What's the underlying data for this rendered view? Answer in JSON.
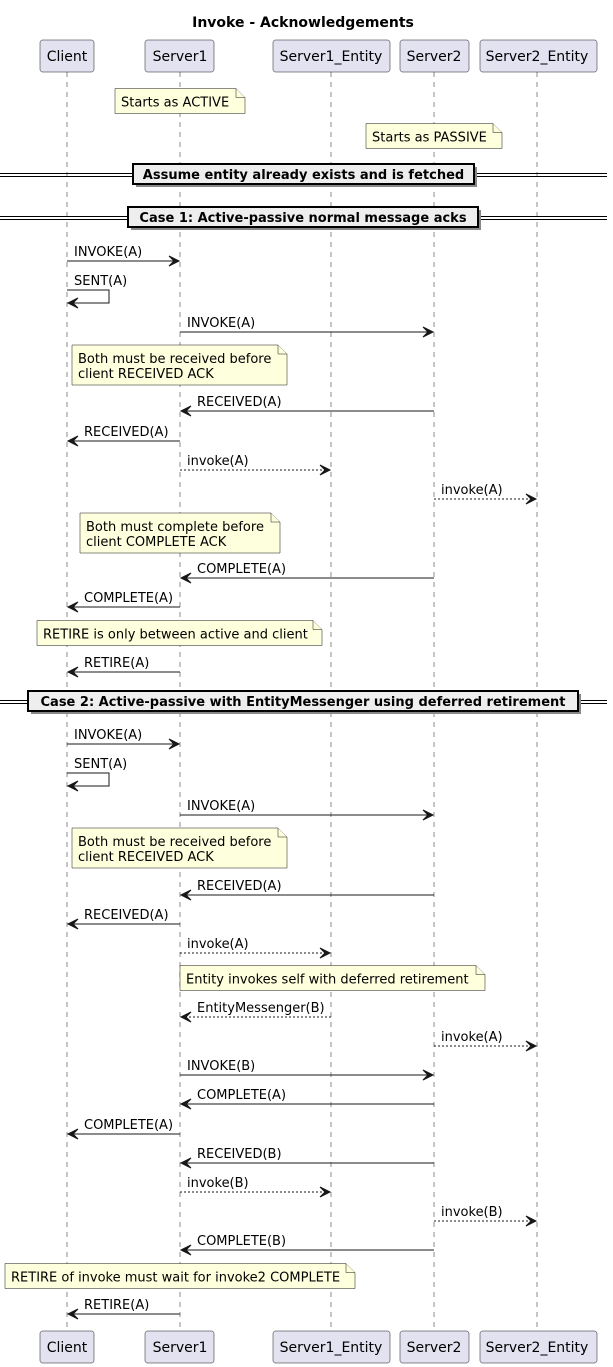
{
  "title": "Invoke - Acknowledgements",
  "participants": [
    {
      "id": "client",
      "label": "Client"
    },
    {
      "id": "server1",
      "label": "Server1"
    },
    {
      "id": "server1_entity",
      "label": "Server1_Entity"
    },
    {
      "id": "server2",
      "label": "Server2"
    },
    {
      "id": "server2_entity",
      "label": "Server2_Entity"
    }
  ],
  "colors": {
    "participant_fill": "#E2E2F0",
    "note_fill": "#FEFFDD",
    "divider_fill": "#EEEEEE",
    "line": "#181818"
  },
  "steps": [
    {
      "kind": "note",
      "over": "server1",
      "lines": [
        "Starts as ACTIVE"
      ]
    },
    {
      "kind": "note",
      "over": "server2",
      "lines": [
        "Starts as PASSIVE"
      ]
    },
    {
      "kind": "divider",
      "text": "Assume entity already exists and is fetched"
    },
    {
      "kind": "divider",
      "text": "Case 1:  Active-passive normal message acks"
    },
    {
      "kind": "message",
      "from": "client",
      "to": "server1",
      "label": "INVOKE(A)",
      "style": "solid"
    },
    {
      "kind": "message",
      "from": "client",
      "to": "client",
      "label": "SENT(A)",
      "style": "solid"
    },
    {
      "kind": "message",
      "from": "server1",
      "to": "server2",
      "label": "INVOKE(A)",
      "style": "solid"
    },
    {
      "kind": "note",
      "over": "client-server1",
      "lines": [
        "Both must be received before",
        "client RECEIVED ACK"
      ]
    },
    {
      "kind": "message",
      "from": "server2",
      "to": "server1",
      "label": "RECEIVED(A)",
      "style": "solid"
    },
    {
      "kind": "message",
      "from": "server1",
      "to": "client",
      "label": "RECEIVED(A)",
      "style": "solid"
    },
    {
      "kind": "message",
      "from": "server1",
      "to": "server1_entity",
      "label": "invoke(A)",
      "style": "dashed"
    },
    {
      "kind": "message",
      "from": "server2",
      "to": "server2_entity",
      "label": "invoke(A)",
      "style": "dashed"
    },
    {
      "kind": "note",
      "over": "client-server1",
      "lines": [
        "Both must complete before",
        "client COMPLETE ACK"
      ]
    },
    {
      "kind": "message",
      "from": "server2",
      "to": "server1",
      "label": "COMPLETE(A)",
      "style": "solid"
    },
    {
      "kind": "message",
      "from": "server1",
      "to": "client",
      "label": "COMPLETE(A)",
      "style": "solid"
    },
    {
      "kind": "note",
      "over": "client-server1_entity",
      "lines": [
        "RETIRE is only between active and client"
      ]
    },
    {
      "kind": "message",
      "from": "server1",
      "to": "client",
      "label": "RETIRE(A)",
      "style": "solid"
    },
    {
      "kind": "divider",
      "text": "Case 2:  Active-passive with EntityMessenger using deferred retirement"
    },
    {
      "kind": "message",
      "from": "client",
      "to": "server1",
      "label": "INVOKE(A)",
      "style": "solid"
    },
    {
      "kind": "message",
      "from": "client",
      "to": "client",
      "label": "SENT(A)",
      "style": "solid"
    },
    {
      "kind": "message",
      "from": "server1",
      "to": "server2",
      "label": "INVOKE(A)",
      "style": "solid"
    },
    {
      "kind": "note",
      "over": "client-server1",
      "lines": [
        "Both must be received before",
        "client RECEIVED ACK"
      ]
    },
    {
      "kind": "message",
      "from": "server2",
      "to": "server1",
      "label": "RECEIVED(A)",
      "style": "solid"
    },
    {
      "kind": "message",
      "from": "server1",
      "to": "client",
      "label": "RECEIVED(A)",
      "style": "solid"
    },
    {
      "kind": "message",
      "from": "server1",
      "to": "server1_entity",
      "label": "invoke(A)",
      "style": "dashed"
    },
    {
      "kind": "note",
      "over": "server1-server2",
      "lines": [
        "Entity invokes self with deferred retirement"
      ]
    },
    {
      "kind": "message",
      "from": "server1_entity",
      "to": "server1",
      "label": "EntityMessenger(B)",
      "style": "dashed"
    },
    {
      "kind": "message",
      "from": "server2",
      "to": "server2_entity",
      "label": "invoke(A)",
      "style": "dashed"
    },
    {
      "kind": "message",
      "from": "server1",
      "to": "server2",
      "label": "INVOKE(B)",
      "style": "solid"
    },
    {
      "kind": "message",
      "from": "server2",
      "to": "server1",
      "label": "COMPLETE(A)",
      "style": "solid"
    },
    {
      "kind": "message",
      "from": "server1",
      "to": "client",
      "label": "COMPLETE(A)",
      "style": "solid"
    },
    {
      "kind": "message",
      "from": "server2",
      "to": "server1",
      "label": "RECEIVED(B)",
      "style": "solid"
    },
    {
      "kind": "message",
      "from": "server1",
      "to": "server1_entity",
      "label": "invoke(B)",
      "style": "dashed"
    },
    {
      "kind": "message",
      "from": "server2",
      "to": "server2_entity",
      "label": "invoke(B)",
      "style": "dashed"
    },
    {
      "kind": "message",
      "from": "server2",
      "to": "server1",
      "label": "COMPLETE(B)",
      "style": "solid"
    },
    {
      "kind": "note",
      "over": "client-server1_entity",
      "lines": [
        "RETIRE of invoke must wait for invoke2 COMPLETE"
      ]
    },
    {
      "kind": "message",
      "from": "server1",
      "to": "client",
      "label": "RETIRE(A)",
      "style": "solid"
    }
  ]
}
